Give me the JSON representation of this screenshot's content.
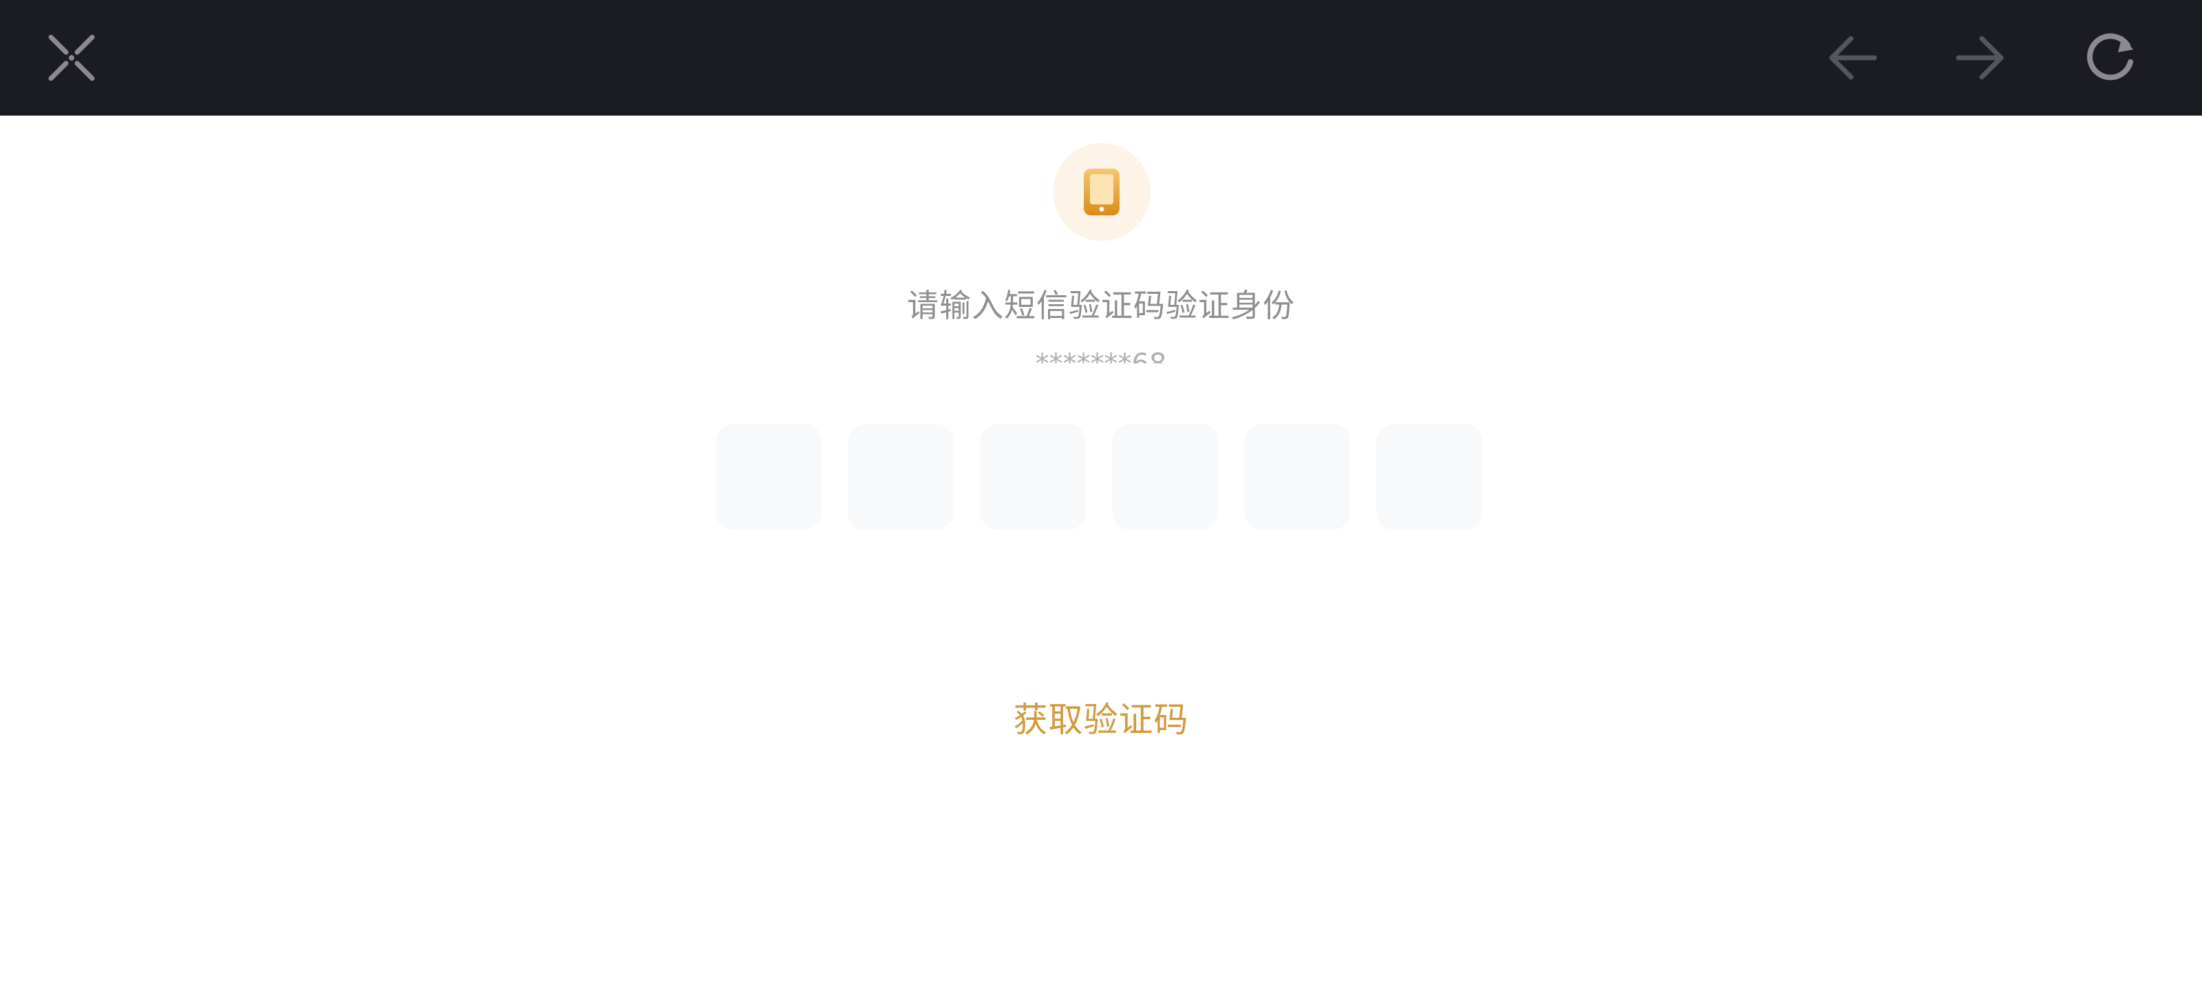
{
  "toolbar": {
    "close_icon": "close-icon",
    "back_icon": "arrow-left-icon",
    "forward_icon": "arrow-right-icon",
    "refresh_icon": "refresh-icon"
  },
  "verify": {
    "icon": "phone-icon",
    "prompt": "请输入短信验证码验证身份",
    "masked_phone": "*******68",
    "code_digits": [
      "",
      "",
      "",
      "",
      "",
      ""
    ],
    "get_code_label": "获取验证码"
  },
  "colors": {
    "topbar": "#1b1b24",
    "accent": "#d29a3c",
    "icon_circle": "#fdf3e6",
    "code_box": "#f8f9fb"
  }
}
